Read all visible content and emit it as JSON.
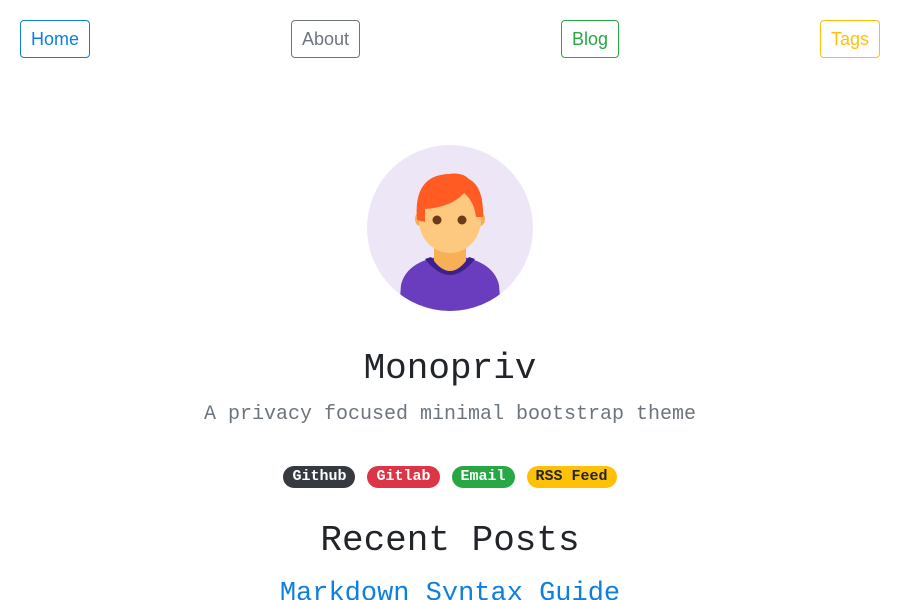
{
  "nav": {
    "items": [
      {
        "label": "Home",
        "color": "#0d7fe0"
      },
      {
        "label": "About",
        "color": "#6c757d"
      },
      {
        "label": "Blog",
        "color": "#28a745"
      },
      {
        "label": "Tags",
        "color": "#ffc107"
      }
    ]
  },
  "profile": {
    "avatar_icon": "person-avatar-icon",
    "title": "Monopriv",
    "subtitle": "A privacy focused minimal bootstrap theme"
  },
  "social": {
    "links": [
      {
        "label": "Github",
        "color": "#343a40"
      },
      {
        "label": "Gitlab",
        "color": "#dc3545"
      },
      {
        "label": "Email",
        "color": "#28a745"
      },
      {
        "label": "RSS Feed",
        "color": "#ffc107"
      }
    ]
  },
  "recent_posts": {
    "heading": "Recent Posts",
    "items": [
      {
        "title": "Markdown Syntax Guide"
      }
    ]
  }
}
